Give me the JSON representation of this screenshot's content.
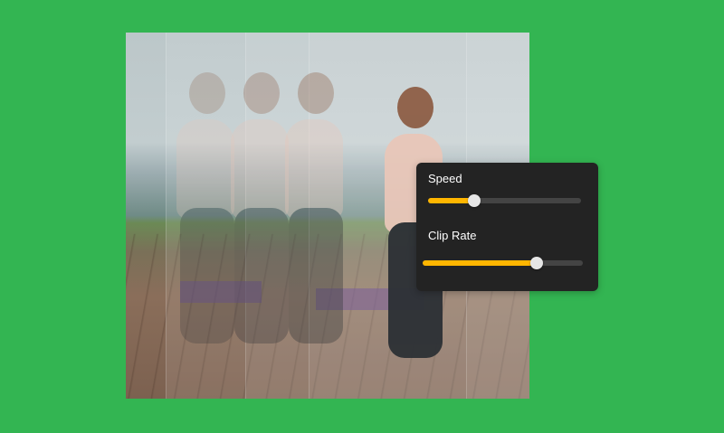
{
  "controls": {
    "speed": {
      "label": "Speed",
      "value": 0.3
    },
    "clip_rate": {
      "label": "Clip Rate",
      "value": 0.71
    }
  },
  "colors": {
    "background": "#33b552",
    "panel": "#232323",
    "accent": "#ffb600",
    "track": "#444444",
    "thumb": "#e6e6e6"
  }
}
